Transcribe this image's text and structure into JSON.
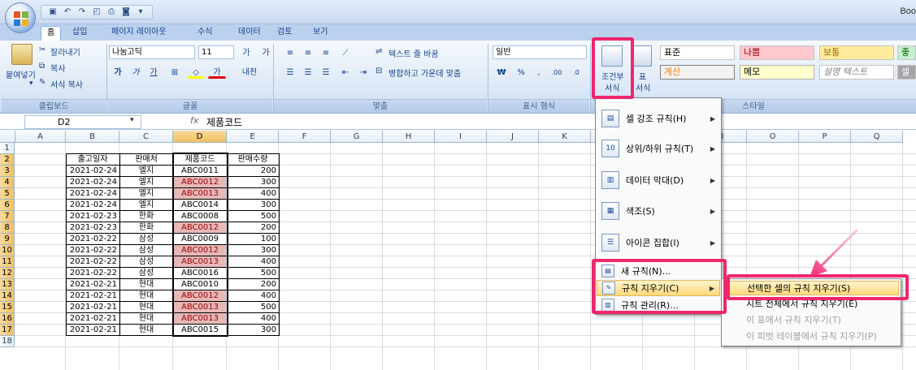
{
  "window": {
    "title_fragment": "Boo"
  },
  "tabs": [
    "홈",
    "삽입",
    "페이지 레이아웃",
    "수식",
    "데이터",
    "검토",
    "보기"
  ],
  "clipboard": {
    "cut": "잘라내기",
    "copy": "복사",
    "paste": "붙여넣기",
    "format_painter": "서식 복사",
    "group": "클립보드"
  },
  "font": {
    "name": "나눔고딕",
    "size": "11",
    "group": "글꼴"
  },
  "alignment": {
    "wrap": "텍스트 줄 바꿈",
    "merge": "병합하고 가운데 맞춤",
    "group": "맞춤"
  },
  "number": {
    "format": "일반",
    "group": "표시 형식"
  },
  "conditional_format": {
    "label_line1": "조건부",
    "label_line2": "서식"
  },
  "table_format": {
    "label_line1": "표",
    "label_line2": "서식"
  },
  "styles": {
    "group": "스타일",
    "cells": [
      "표준",
      "나쁨",
      "보통",
      "좋",
      "계산",
      "메모",
      "설명 텍스트",
      "셀"
    ]
  },
  "formula_bar": {
    "name_box": "D2",
    "fx": "fx",
    "value": "제품코드"
  },
  "columns": [
    "A",
    "B",
    "C",
    "D",
    "E",
    "F",
    "G",
    "H",
    "I",
    "J",
    "K",
    "L",
    "M",
    "N",
    "O",
    "P",
    "Q"
  ],
  "rows": [
    "1",
    "2",
    "3",
    "4",
    "5",
    "6",
    "7",
    "8",
    "9",
    "10",
    "11",
    "12",
    "13",
    "14",
    "15",
    "16",
    "17",
    "18"
  ],
  "table": {
    "headers": [
      "출고일자",
      "판매처",
      "제품코드",
      "판매수량"
    ],
    "rows": [
      [
        "2021-02-24",
        "엘지",
        "ABC0011",
        "200"
      ],
      [
        "2021-02-24",
        "엘지",
        "ABC0012",
        "300"
      ],
      [
        "2021-02-24",
        "엘지",
        "ABC0013",
        "400"
      ],
      [
        "2021-02-24",
        "엘지",
        "ABC0014",
        "300"
      ],
      [
        "2021-02-23",
        "한화",
        "ABC0008",
        "500"
      ],
      [
        "2021-02-23",
        "한화",
        "ABC0012",
        "200"
      ],
      [
        "2021-02-22",
        "삼성",
        "ABC0009",
        "100"
      ],
      [
        "2021-02-22",
        "삼성",
        "ABC0012",
        "300"
      ],
      [
        "2021-02-22",
        "삼성",
        "ABC0013",
        "400"
      ],
      [
        "2021-02-22",
        "삼성",
        "ABC0016",
        "500"
      ],
      [
        "2021-02-21",
        "현대",
        "ABC0010",
        "200"
      ],
      [
        "2021-02-21",
        "현대",
        "ABC0012",
        "400"
      ],
      [
        "2021-02-21",
        "현대",
        "ABC0013",
        "500"
      ],
      [
        "2021-02-21",
        "현대",
        "ABC0013",
        "400"
      ],
      [
        "2021-02-21",
        "현대",
        "ABC0015",
        "300"
      ]
    ],
    "highlighted_rows": [
      1,
      2,
      5,
      7,
      8,
      11,
      12,
      13
    ],
    "highlight_color": "#e6b8b7"
  },
  "cf_menu": {
    "items": [
      {
        "label": "셀 강조 규칙(H)",
        "icon": "highlight-rules-icon"
      },
      {
        "label": "상위/하위 규칙(T)",
        "icon": "top-bottom-icon"
      },
      {
        "label": "데이터 막대(D)",
        "icon": "data-bars-icon"
      },
      {
        "label": "색조(S)",
        "icon": "color-scales-icon"
      },
      {
        "label": "아이콘 집합(I)",
        "icon": "icon-sets-icon"
      }
    ],
    "small_items": [
      {
        "label": "새 규칙(N)...",
        "icon": "new-rule-icon"
      },
      {
        "label": "규칙 지우기(C)",
        "icon": "clear-rules-icon"
      },
      {
        "label": "규칙 관리(R)...",
        "icon": "manage-rules-icon"
      }
    ]
  },
  "clear_submenu": {
    "items": [
      {
        "label": "선택한 셀의 규칙 지우기(S)",
        "enabled": true
      },
      {
        "label": "시트 전체에서 규칙 지우기(E)",
        "enabled": true
      },
      {
        "label": "이 표에서 규칙 지우기(T)",
        "enabled": false
      },
      {
        "label": "이 피벗 테이블에서 규칙 지우기(P)",
        "enabled": false
      }
    ]
  },
  "accent": {
    "highlight": "#f0266f",
    "selected_header": "#f1c15f"
  }
}
